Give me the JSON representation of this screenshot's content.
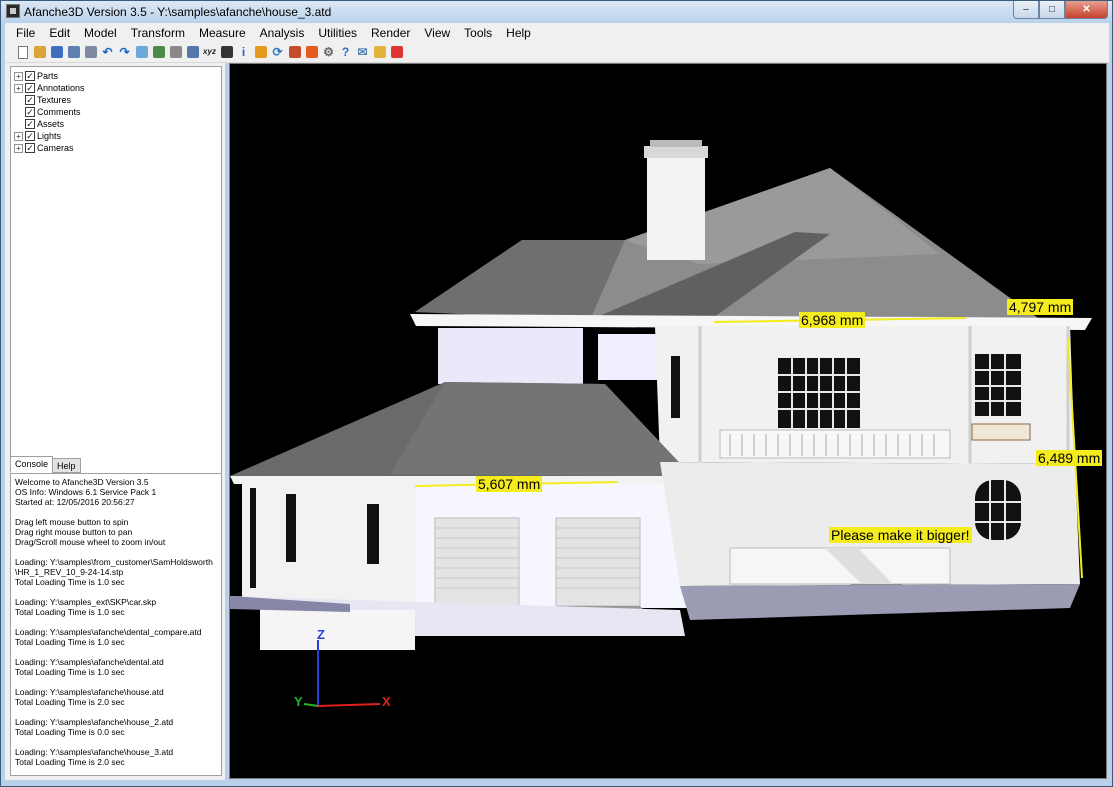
{
  "window": {
    "title": "Afanche3D Version 3.5 - Y:\\samples\\afanche\\house_3.atd",
    "buttons": {
      "minimize": "–",
      "maximize": "□",
      "close": "✕"
    }
  },
  "menu": [
    "File",
    "Edit",
    "Model",
    "Transform",
    "Measure",
    "Analysis",
    "Utilities",
    "Render",
    "View",
    "Tools",
    "Help"
  ],
  "toolbar": [
    {
      "name": "new-file-icon",
      "glyph": "",
      "color": "#ffffff"
    },
    {
      "name": "open-folder-icon",
      "glyph": "",
      "color": "#d9a43a"
    },
    {
      "name": "save-icon",
      "glyph": "",
      "color": "#3d6ec0"
    },
    {
      "name": "save-as-icon",
      "glyph": "",
      "color": "#5f7fb0"
    },
    {
      "name": "print-icon",
      "glyph": "",
      "color": "#7d8aa0"
    },
    {
      "name": "undo-icon",
      "glyph": "↶",
      "color": "#1f64c8"
    },
    {
      "name": "redo-icon",
      "glyph": "↷",
      "color": "#1f64c8"
    },
    {
      "name": "comment-icon",
      "glyph": "",
      "color": "#6aa9d9"
    },
    {
      "name": "layers-icon",
      "glyph": "",
      "color": "#4c8b4c"
    },
    {
      "name": "measure-icon",
      "glyph": "",
      "color": "#888888"
    },
    {
      "name": "grid-icon",
      "glyph": "",
      "color": "#5577aa"
    },
    {
      "name": "xyz-icon",
      "glyph": "xyz",
      "color": ""
    },
    {
      "name": "film-icon",
      "glyph": "",
      "color": "#333333"
    },
    {
      "name": "info-icon",
      "glyph": "i",
      "color": "#1e67c7"
    },
    {
      "name": "warning-icon",
      "glyph": "",
      "color": "#e39a1e"
    },
    {
      "name": "refresh-icon",
      "glyph": "⟳",
      "color": "#2e79c9"
    },
    {
      "name": "palette-icon",
      "glyph": "",
      "color": "#c74c2b"
    },
    {
      "name": "color-cube-icon",
      "glyph": "",
      "color": "#e65c1e"
    },
    {
      "name": "gear-icon",
      "glyph": "⚙",
      "color": "#666666"
    },
    {
      "name": "help-icon",
      "glyph": "?",
      "color": "#2c6fd1"
    },
    {
      "name": "mail-icon",
      "glyph": "✉",
      "color": "#5c86b8"
    },
    {
      "name": "tag-icon",
      "glyph": "",
      "color": "#e3b43a"
    },
    {
      "name": "exit-icon",
      "glyph": "",
      "color": "#d33"
    }
  ],
  "tree": [
    {
      "label": "Parts",
      "expandable": true,
      "checked": true
    },
    {
      "label": "Annotations",
      "expandable": true,
      "checked": true
    },
    {
      "label": "Textures",
      "expandable": false,
      "checked": true
    },
    {
      "label": "Comments",
      "expandable": false,
      "checked": true
    },
    {
      "label": "Assets",
      "expandable": false,
      "checked": true
    },
    {
      "label": "Lights",
      "expandable": true,
      "checked": true
    },
    {
      "label": "Cameras",
      "expandable": true,
      "checked": true
    }
  ],
  "tabs": [
    {
      "label": "Console",
      "active": true
    },
    {
      "label": "Help",
      "active": false
    }
  ],
  "console": [
    "Welcome to Afanche3D Version 3.5",
    "OS Info: Windows 6.1 Service Pack 1",
    "Started at: 12/05/2016 20:56:27",
    "",
    "Drag left mouse button to spin",
    "Drag right mouse button to pan",
    "Drag/Scroll mouse wheel to zoom in/out",
    "",
    "Loading: Y:\\samples\\from_customer\\SamHoldsworth",
    "\\HR_1_REV_10_9-24-14.stp",
    "Total Loading Time is 1.0 sec",
    "",
    "Loading: Y:\\samples_ext\\SKP\\car.skp",
    "Total Loading Time is 1.0 sec",
    "",
    "Loading: Y:\\samples\\afanche\\dental_compare.atd",
    "Total Loading Time is 1.0 sec",
    "",
    "Loading: Y:\\samples\\afanche\\dental.atd",
    "Total Loading Time is 1.0 sec",
    "",
    "Loading: Y:\\samples\\afanche\\house.atd",
    "Total Loading Time is 2.0 sec",
    "",
    "Loading: Y:\\samples\\afanche\\house_2.atd",
    "Total Loading Time is 0.0 sec",
    "",
    "Loading: Y:\\samples\\afanche\\house_3.atd",
    "Total Loading Time is 2.0 sec"
  ],
  "viewport": {
    "dimensions": {
      "d1": "6,968 mm",
      "d2": "4,797 mm",
      "d3": "6,489 mm",
      "d4": "5,607 mm"
    },
    "comment": "Please make it bigger!",
    "axes": {
      "x": "X",
      "y": "Y",
      "z": "Z"
    },
    "colors": {
      "dimension": "#f5ec1e",
      "x_axis": "#e02020",
      "y_axis": "#1fb82a",
      "z_axis": "#2b3fe0"
    }
  }
}
